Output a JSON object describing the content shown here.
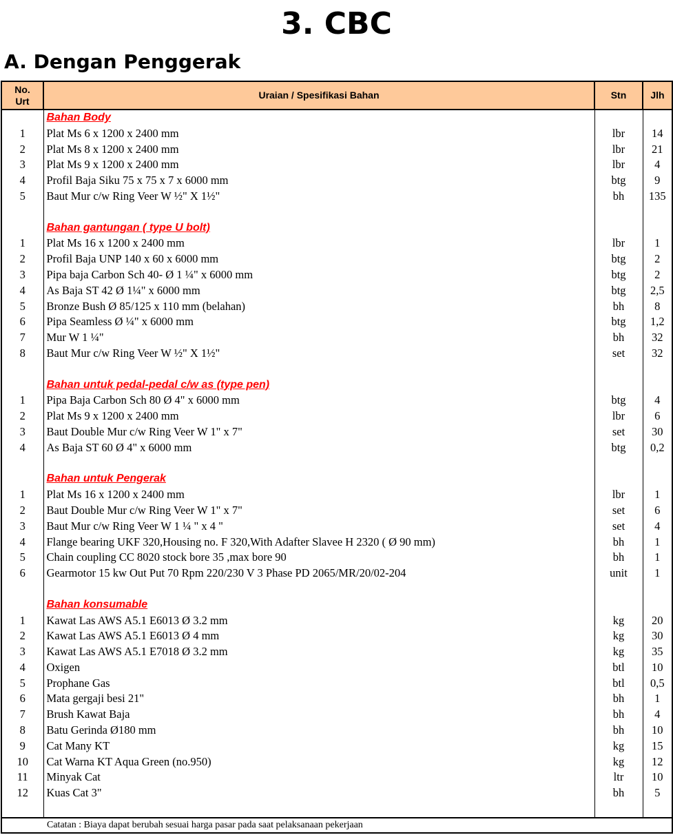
{
  "title": "3. CBC",
  "subtitle": "A. Dengan Penggerak",
  "table": {
    "headers": {
      "no": "No. Urt",
      "desc": "Uraian / Spesifikasi Bahan",
      "stn": "Stn",
      "jlh": "Jlh"
    },
    "sections": [
      {
        "title": "Bahan Body",
        "items": [
          {
            "no": "1",
            "desc": "Plat Ms 6 x 1200 x 2400 mm",
            "stn": "lbr",
            "jlh": "14"
          },
          {
            "no": "2",
            "desc": "Plat Ms 8 x 1200 x 2400 mm",
            "stn": "lbr",
            "jlh": "21"
          },
          {
            "no": "3",
            "desc": "Plat Ms 9 x 1200 x 2400 mm",
            "stn": "lbr",
            "jlh": "4"
          },
          {
            "no": "4",
            "desc": "Profil Baja Siku 75 x 75 x 7 x 6000 mm",
            "stn": "btg",
            "jlh": "9"
          },
          {
            "no": "5",
            "desc": "Baut Mur c/w Ring Veer W ½\" X 1½\"",
            "stn": "bh",
            "jlh": "135"
          }
        ]
      },
      {
        "title": "Bahan gantungan ( type U bolt)",
        "items": [
          {
            "no": "1",
            "desc": "Plat Ms 16 x 1200 x 2400 mm",
            "stn": "lbr",
            "jlh": "1"
          },
          {
            "no": "2",
            "desc": "Profil Baja UNP 140 x 60 x 6000 mm",
            "stn": "btg",
            "jlh": "2"
          },
          {
            "no": "3",
            "desc": "Pipa baja Carbon Sch 40- Ø 1 ¼\" x 6000 mm",
            "stn": "btg",
            "jlh": "2"
          },
          {
            "no": "4",
            "desc": "As Baja ST 42 Ø 1¼\" x 6000 mm",
            "stn": "btg",
            "jlh": "2,5"
          },
          {
            "no": "5",
            "desc": "Bronze Bush Ø 85/125 x 110 mm (belahan)",
            "stn": "bh",
            "jlh": "8"
          },
          {
            "no": "6",
            "desc": "Pipa Seamless Ø ¼\" x 6000 mm",
            "stn": "btg",
            "jlh": "1,2"
          },
          {
            "no": "7",
            "desc": "Mur W 1 ¼\"",
            "stn": "bh",
            "jlh": "32"
          },
          {
            "no": "8",
            "desc": "Baut Mur c/w Ring Veer W ½\" X 1½\"",
            "stn": "set",
            "jlh": "32"
          }
        ]
      },
      {
        "title": "Bahan untuk pedal-pedal c/w as (type pen)",
        "items": [
          {
            "no": "1",
            "desc": "Pipa Baja Carbon Sch 80 Ø 4\" x 6000 mm",
            "stn": "btg",
            "jlh": "4"
          },
          {
            "no": "2",
            "desc": "Plat Ms 9 x 1200 x 2400 mm",
            "stn": "lbr",
            "jlh": "6"
          },
          {
            "no": "3",
            "desc": "Baut Double Mur c/w Ring Veer W 1\" x 7\"",
            "stn": "set",
            "jlh": "30"
          },
          {
            "no": "4",
            "desc": "As Baja ST 60 Ø 4\" x 6000 mm",
            "stn": "btg",
            "jlh": "0,2"
          }
        ]
      },
      {
        "title": "Bahan untuk Pengerak",
        "items": [
          {
            "no": "1",
            "desc": "Plat Ms 16 x 1200 x 2400 mm",
            "stn": "lbr",
            "jlh": "1"
          },
          {
            "no": "2",
            "desc": "Baut Double Mur c/w Ring Veer W 1\" x 7\"",
            "stn": "set",
            "jlh": "6"
          },
          {
            "no": "3",
            "desc": "Baut Mur c/w Ring Veer W 1 ¼ \" x 4 \"",
            "stn": "set",
            "jlh": "4"
          },
          {
            "no": "4",
            "desc": "Flange bearing UKF 320,Housing no. F 320,With Adafter Slavee H 2320 ( Ø 90 mm)",
            "stn": "bh",
            "jlh": "1"
          },
          {
            "no": "5",
            "desc": "Chain coupling CC 8020 stock bore 35 ,max bore 90",
            "stn": "bh",
            "jlh": "1"
          },
          {
            "no": "6",
            "desc": "Gearmotor 15 kw Out Put 70 Rpm 220/230 V 3 Phase PD 2065/MR/20/02-204",
            "stn": "unit",
            "jlh": "1"
          }
        ]
      },
      {
        "title": "Bahan konsumable",
        "items": [
          {
            "no": "1",
            "desc": "Kawat Las AWS A5.1 E6013 Ø 3.2 mm",
            "stn": "kg",
            "jlh": "20"
          },
          {
            "no": "2",
            "desc": "Kawat Las AWS A5.1 E6013 Ø 4 mm",
            "stn": "kg",
            "jlh": "30"
          },
          {
            "no": "3",
            "desc": "Kawat Las AWS A5.1 E7018 Ø 3.2 mm",
            "stn": "kg",
            "jlh": "35"
          },
          {
            "no": "4",
            "desc": "Oxigen",
            "stn": "btl",
            "jlh": "10"
          },
          {
            "no": "5",
            "desc": "Prophane Gas",
            "stn": "btl",
            "jlh": "0,5"
          },
          {
            "no": "6",
            "desc": "Mata gergaji besi 21\"",
            "stn": "bh",
            "jlh": "1"
          },
          {
            "no": "7",
            "desc": "Brush Kawat Baja",
            "stn": "bh",
            "jlh": "4"
          },
          {
            "no": "8",
            "desc": "Batu Gerinda Ø180 mm",
            "stn": "bh",
            "jlh": "10"
          },
          {
            "no": "9",
            "desc": "Cat Many KT",
            "stn": "kg",
            "jlh": "15"
          },
          {
            "no": "10",
            "desc": "Cat Warna KT Aqua Green (no.950)",
            "stn": "kg",
            "jlh": "12"
          },
          {
            "no": "11",
            "desc": "Minyak Cat",
            "stn": "ltr",
            "jlh": "10"
          },
          {
            "no": "12",
            "desc": "Kuas Cat 3\"",
            "stn": "bh",
            "jlh": "5"
          }
        ]
      }
    ],
    "note": "Catatan : Biaya dapat berubah sesuai harga pasar pada saat pelaksanaan pekerjaan"
  },
  "colors": {
    "header_bg": "#fec99a",
    "section_title": "#ff0000"
  }
}
